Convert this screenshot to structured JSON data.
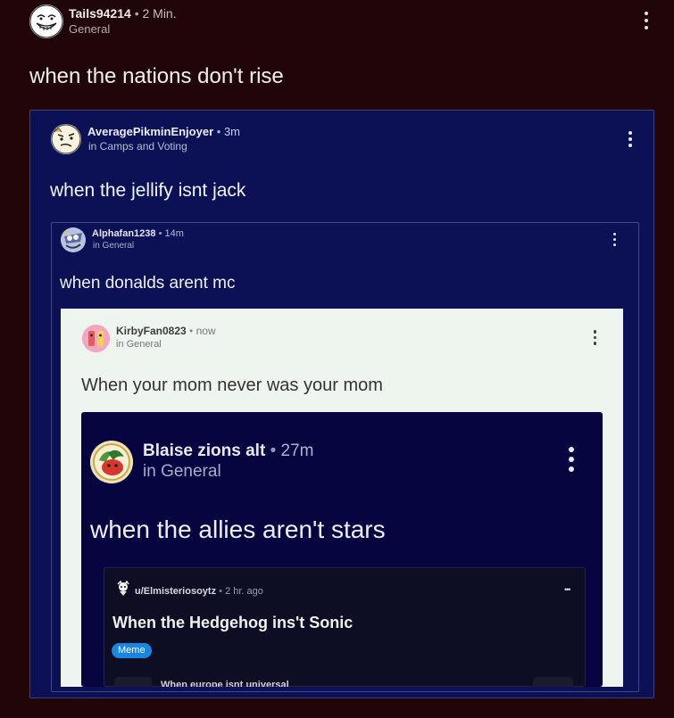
{
  "post": {
    "username": "Tails94214",
    "separator": "•",
    "time": "2 Min.",
    "community": "General",
    "title": "when the nations don't rise"
  },
  "embed1": {
    "username": "AveragePikminEnjoyer",
    "separator": "•",
    "time": "3m",
    "community": "in Camps and Voting",
    "title": "when the jellify isnt jack"
  },
  "embed2": {
    "username": "Alphafan1238",
    "separator": "•",
    "time": "14m",
    "community": "in General",
    "title": "when donalds arent mc"
  },
  "embed3": {
    "username": "KirbyFan0823",
    "separator": "•",
    "time": "now",
    "community": "in General",
    "title": "When your mom never was your mom"
  },
  "embed4": {
    "username": "Blaise zions alt",
    "separator": "•",
    "time": "27m",
    "community": "in General",
    "title": "when the allies aren't stars"
  },
  "embed5": {
    "username": "u/Elmisteriosoytz",
    "separator": "•",
    "time": "2 hr. ago",
    "title": "When the Hedgehog ins't Sonic",
    "flair": "Meme",
    "more": "•••",
    "subtitle": "When europe isnt universal"
  },
  "colors": {
    "background": "#200608",
    "card1": "#0b1154",
    "card3": "#eef5ef",
    "card4": "#070540",
    "flair": "#1a86e0"
  }
}
